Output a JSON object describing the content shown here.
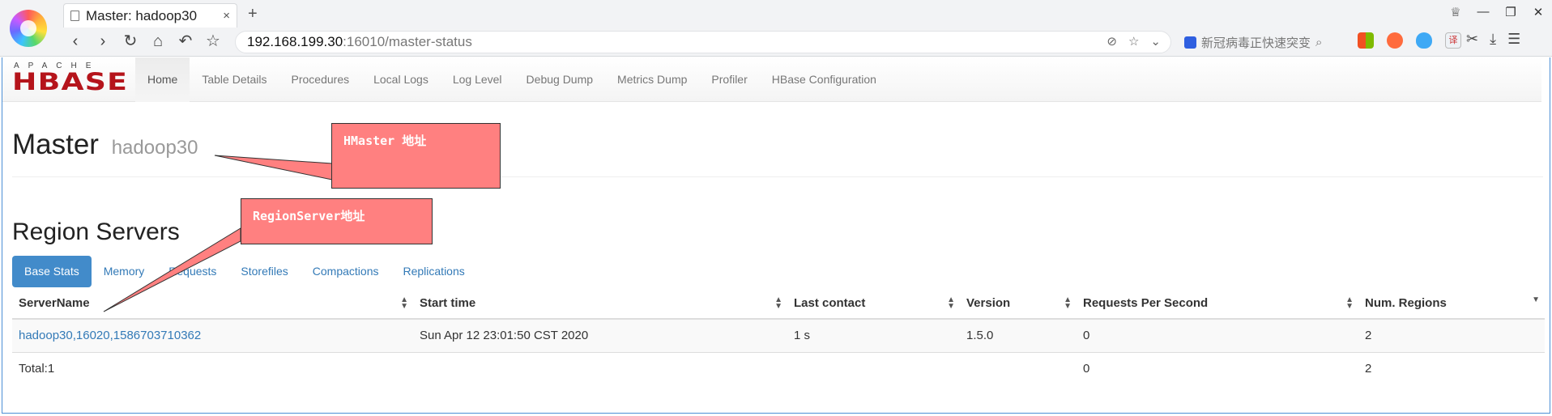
{
  "browser": {
    "tab_title": "Master: hadoop30",
    "tab_close": "×",
    "new_tab": "+",
    "address_host": "192.168.199.30",
    "address_rest": ":16010/master-status",
    "search_placeholder": "新冠病毒正快速突变",
    "translate_ext_label": "译"
  },
  "navbar": {
    "logo_apache": "APACHE",
    "logo_hbase": "HBASE",
    "links": [
      "Home",
      "Table Details",
      "Procedures",
      "Local Logs",
      "Log Level",
      "Debug Dump",
      "Metrics Dump",
      "Profiler",
      "HBase Configuration"
    ]
  },
  "master": {
    "label": "Master",
    "host": "hadoop30"
  },
  "region_servers": {
    "title": "Region Servers",
    "tabs": [
      "Base Stats",
      "Memory",
      "Requests",
      "Storefiles",
      "Compactions",
      "Replications"
    ],
    "columns": [
      "ServerName",
      "Start time",
      "Last contact",
      "Version",
      "Requests Per Second",
      "Num. Regions"
    ],
    "rows": [
      {
        "server_name": "hadoop30,16020,1586703710362",
        "start_time": "Sun Apr 12 23:01:50 CST 2020",
        "last_contact": "1 s",
        "version": "1.5.0",
        "requests_per_second": "0",
        "num_regions": "2"
      }
    ],
    "total": {
      "label": "Total:1",
      "requests_per_second": "0",
      "num_regions": "2"
    }
  },
  "annotations": {
    "hmaster": "HMaster 地址",
    "regionserver": "RegionServer地址",
    "color": "#ff8080"
  }
}
